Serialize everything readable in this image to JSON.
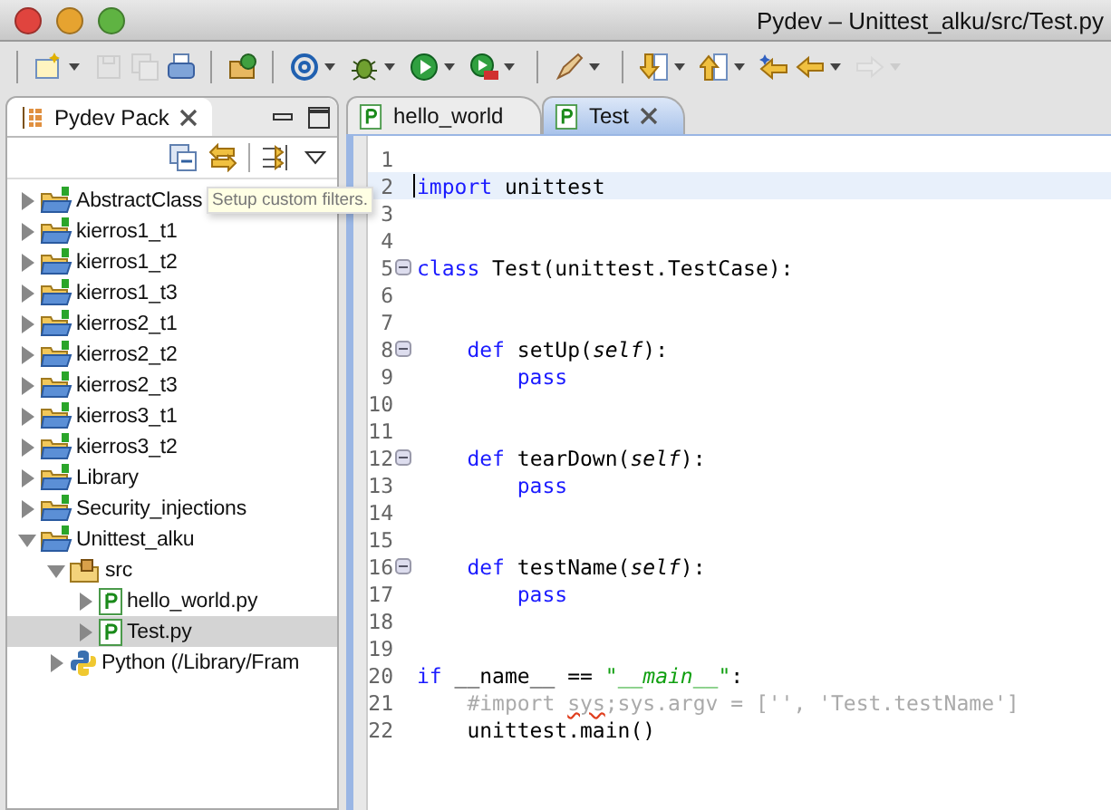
{
  "window": {
    "title": "Pydev – Unittest_alku/src/Test.py"
  },
  "toolbar": [
    {
      "kind": "new",
      "dropdown": true,
      "disabled": false,
      "group_start": true
    },
    {
      "kind": "save",
      "dropdown": false,
      "disabled": true,
      "group_start": false
    },
    {
      "kind": "save-all",
      "dropdown": false,
      "disabled": true,
      "group_start": false
    },
    {
      "kind": "print",
      "dropdown": false,
      "disabled": false,
      "group_start": false
    },
    {
      "kind": "open-folder",
      "dropdown": false,
      "disabled": false,
      "group_start": true
    },
    {
      "kind": "at",
      "dropdown": true,
      "disabled": false,
      "group_start": true
    },
    {
      "kind": "debug",
      "dropdown": true,
      "disabled": false,
      "group_start": false
    },
    {
      "kind": "run",
      "dropdown": true,
      "disabled": false,
      "group_start": false
    },
    {
      "kind": "run-tools",
      "dropdown": true,
      "disabled": false,
      "group_start": false
    },
    {
      "kind": "marker",
      "dropdown": true,
      "disabled": false,
      "group_start": true
    },
    {
      "kind": "next",
      "dropdown": true,
      "disabled": false,
      "group_start": true
    },
    {
      "kind": "prev",
      "dropdown": true,
      "disabled": false,
      "group_start": false
    },
    {
      "kind": "last-edit",
      "dropdown": false,
      "disabled": false,
      "group_start": false
    },
    {
      "kind": "back",
      "dropdown": true,
      "disabled": false,
      "group_start": false
    },
    {
      "kind": "forward",
      "dropdown": true,
      "disabled": true,
      "group_start": false
    }
  ],
  "explorer": {
    "tab": "Pydev Pack",
    "tooltip": "Setup custom filters.",
    "tree": [
      {
        "label": "AbstractClass",
        "kind": "project",
        "expanded": false,
        "selected": false
      },
      {
        "label": "kierros1_t1",
        "kind": "project",
        "expanded": false,
        "selected": false
      },
      {
        "label": "kierros1_t2",
        "kind": "project",
        "expanded": false,
        "selected": false
      },
      {
        "label": "kierros1_t3",
        "kind": "project",
        "expanded": false,
        "selected": false
      },
      {
        "label": "kierros2_t1",
        "kind": "project",
        "expanded": false,
        "selected": false
      },
      {
        "label": "kierros2_t2",
        "kind": "project",
        "expanded": false,
        "selected": false
      },
      {
        "label": "kierros2_t3",
        "kind": "project",
        "expanded": false,
        "selected": false
      },
      {
        "label": "kierros3_t1",
        "kind": "project",
        "expanded": false,
        "selected": false
      },
      {
        "label": "kierros3_t2",
        "kind": "project",
        "expanded": false,
        "selected": false
      },
      {
        "label": "Library",
        "kind": "project",
        "expanded": false,
        "selected": false
      },
      {
        "label": "Security_injections",
        "kind": "project",
        "expanded": false,
        "selected": false
      },
      {
        "label": "Unittest_alku",
        "kind": "project",
        "expanded": true,
        "selected": false,
        "children": [
          {
            "label": "src",
            "kind": "package",
            "expanded": true,
            "selected": false,
            "children": [
              {
                "label": "hello_world.py",
                "kind": "pyfile",
                "expanded": false,
                "selected": false
              },
              {
                "label": "Test.py",
                "kind": "pyfile",
                "expanded": false,
                "selected": true
              }
            ]
          },
          {
            "label": "Python  (/Library/Fram",
            "kind": "interpreter",
            "expanded": false,
            "selected": false
          }
        ]
      }
    ]
  },
  "editor": {
    "tabs": [
      {
        "label": "hello_world",
        "selected": false
      },
      {
        "label": "Test",
        "selected": true
      }
    ],
    "lines": [
      {
        "number": "1",
        "fold": false,
        "current": false
      },
      {
        "number": "2",
        "fold": false,
        "current": true,
        "tokens": [
          {
            "text": "import",
            "kind": "keyword"
          },
          {
            "text": " unittest",
            "kind": "plain"
          }
        ]
      },
      {
        "number": "3",
        "fold": false,
        "current": false
      },
      {
        "number": "4",
        "fold": false,
        "current": false
      },
      {
        "number": "5",
        "fold": true,
        "current": false,
        "tokens": [
          {
            "text": "class",
            "kind": "keyword"
          },
          {
            "text": " Test(unittest.TestCase):",
            "kind": "plain"
          }
        ]
      },
      {
        "number": "6",
        "fold": false,
        "current": false
      },
      {
        "number": "7",
        "fold": false,
        "current": false
      },
      {
        "number": "8",
        "fold": true,
        "current": false,
        "tokens": [
          {
            "text": "    def",
            "kind": "keyword"
          },
          {
            "text": " setUp(",
            "kind": "plain"
          },
          {
            "text": "self",
            "kind": "self"
          },
          {
            "text": "):",
            "kind": "plain"
          }
        ]
      },
      {
        "number": "9",
        "fold": false,
        "current": false,
        "tokens": [
          {
            "text": "        pass",
            "kind": "keyword"
          }
        ]
      },
      {
        "number": "10",
        "fold": false,
        "current": false
      },
      {
        "number": "11",
        "fold": false,
        "current": false
      },
      {
        "number": "12",
        "fold": true,
        "current": false,
        "tokens": [
          {
            "text": "    def",
            "kind": "keyword"
          },
          {
            "text": " tearDown(",
            "kind": "plain"
          },
          {
            "text": "self",
            "kind": "self"
          },
          {
            "text": "):",
            "kind": "plain"
          }
        ]
      },
      {
        "number": "13",
        "fold": false,
        "current": false,
        "tokens": [
          {
            "text": "        pass",
            "kind": "keyword"
          }
        ]
      },
      {
        "number": "14",
        "fold": false,
        "current": false
      },
      {
        "number": "15",
        "fold": false,
        "current": false
      },
      {
        "number": "16",
        "fold": true,
        "current": false,
        "tokens": [
          {
            "text": "    def",
            "kind": "keyword"
          },
          {
            "text": " testName(",
            "kind": "plain"
          },
          {
            "text": "self",
            "kind": "self"
          },
          {
            "text": "):",
            "kind": "plain"
          }
        ]
      },
      {
        "number": "17",
        "fold": false,
        "current": false,
        "tokens": [
          {
            "text": "        pass",
            "kind": "keyword"
          }
        ]
      },
      {
        "number": "18",
        "fold": false,
        "current": false
      },
      {
        "number": "19",
        "fold": false,
        "current": false
      },
      {
        "number": "20",
        "fold": false,
        "current": false,
        "tokens": [
          {
            "text": "if",
            "kind": "keyword"
          },
          {
            "text": " __name__ == ",
            "kind": "plain"
          },
          {
            "text": "\"",
            "kind": "string"
          },
          {
            "text": "__main__",
            "kind": "string-italic"
          },
          {
            "text": "\"",
            "kind": "string"
          },
          {
            "text": ":",
            "kind": "plain"
          }
        ]
      },
      {
        "number": "21",
        "fold": false,
        "current": false,
        "tokens": [
          {
            "text": "    #import ",
            "kind": "comment"
          },
          {
            "text": "sys",
            "kind": "comment-error"
          },
          {
            "text": ";sys.argv = ['', 'Test.testName']",
            "kind": "comment"
          }
        ]
      },
      {
        "number": "22",
        "fold": false,
        "current": false,
        "tokens": [
          {
            "text": "    unittest.main()",
            "kind": "plain"
          }
        ]
      }
    ]
  }
}
